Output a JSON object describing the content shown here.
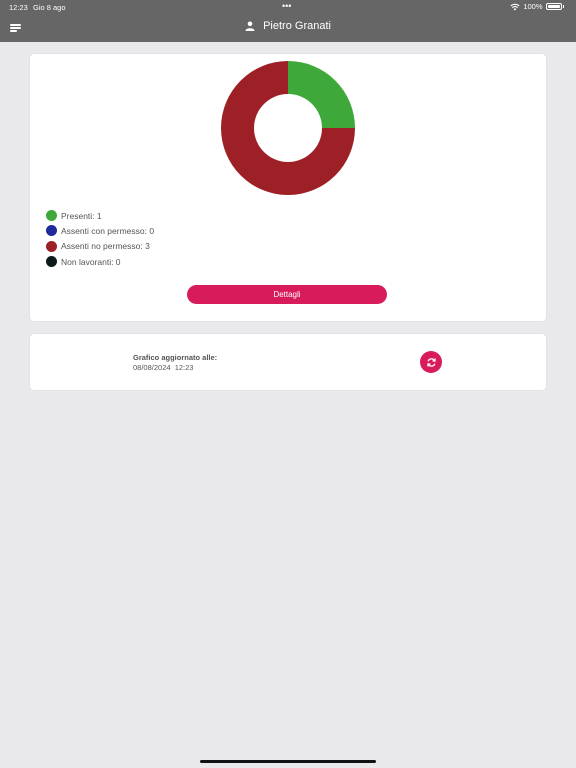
{
  "status_bar": {
    "time": "12:23",
    "date": "Gio 8 ago",
    "multitask": "•••",
    "battery": "100%"
  },
  "header": {
    "user_name": "Pietro Granati",
    "menu_icon": "menu-icon",
    "user_icon": "person-icon"
  },
  "chart_data": {
    "type": "pie",
    "categories": [
      "Presenti",
      "Assenti con permesso",
      "Assenti no permesso",
      "Non lavoranti"
    ],
    "values": [
      1,
      0,
      3,
      0
    ],
    "colors": [
      "#3fa83a",
      "#1f2a9c",
      "#9e2027",
      "#0d1a1c"
    ]
  },
  "legend": [
    {
      "label": "Presenti: 1",
      "color": "#3fa83a"
    },
    {
      "label": "Assenti con permesso: 0",
      "color": "#1f2a9c"
    },
    {
      "label": "Assenti no permesso: 3",
      "color": "#9e2027"
    },
    {
      "label": "Non lavoranti: 0",
      "color": "#0d1a1c"
    }
  ],
  "details_button": "Dettagli",
  "update_info": {
    "label": "Grafico aggiornato alle:",
    "value": "08/08/2024  12:23"
  },
  "colors": {
    "accent": "#d81b5a",
    "header": "#666666",
    "background": "#e9e9eb"
  }
}
